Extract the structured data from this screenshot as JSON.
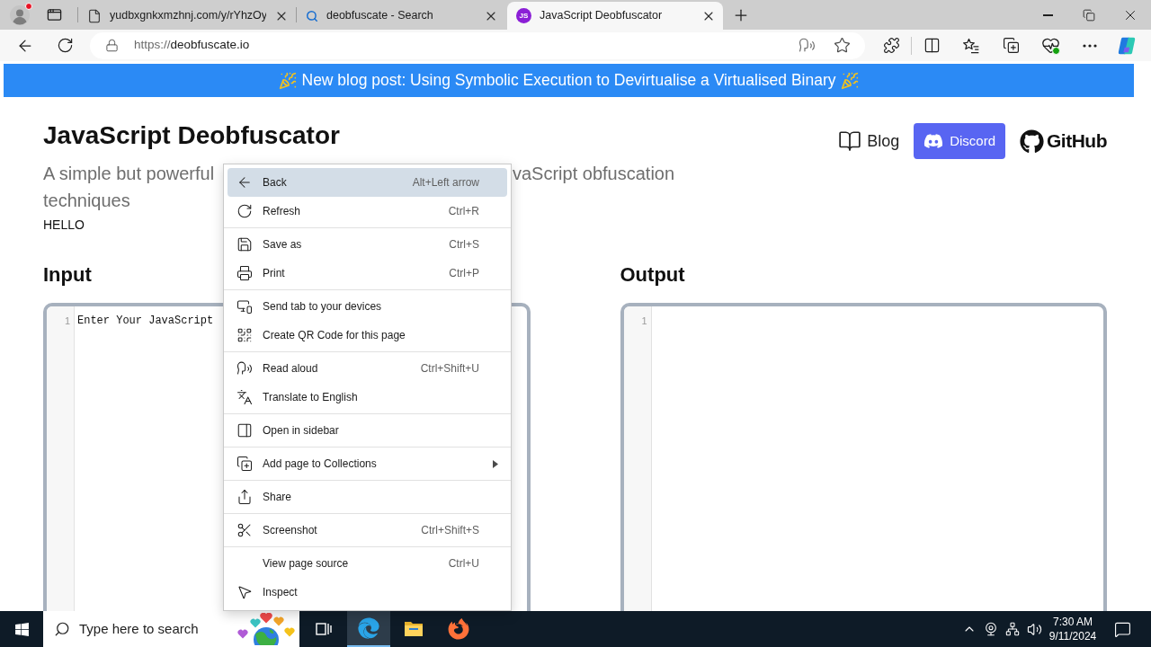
{
  "browser": {
    "tabs": [
      {
        "title": "yudbxgnkxmzhnj.com/y/rYhzOy",
        "selected": false
      },
      {
        "title": "deobfuscate - Search",
        "selected": false
      },
      {
        "title": "JavaScript Deobfuscator",
        "favicon_text": "JS",
        "selected": true
      }
    ],
    "address": {
      "scheme": "https://",
      "host": "deobfuscate.io"
    }
  },
  "page": {
    "banner": {
      "text": "New blog post: Using Symbolic Execution to Devirtualise a Virtualised Binary"
    },
    "title": "JavaScript Deobfuscator",
    "nav": [
      {
        "label": "Blog",
        "kind": "link"
      },
      {
        "label": "Discord",
        "kind": "button"
      },
      {
        "label": "GitHub",
        "kind": "logo"
      }
    ],
    "subtitle": {
      "line_1_start": "A simple but powerful",
      "line_1_end": "vaScript obfuscation",
      "line_2": "techniques"
    },
    "note": "HELLO",
    "input": {
      "heading": "Input",
      "line_numbers": [
        "1"
      ],
      "placeholder": "Enter Your JavaScript"
    },
    "output": {
      "heading": "Output",
      "line_numbers": [
        "1"
      ]
    }
  },
  "context_menu": {
    "groups": [
      [
        {
          "label": "Back",
          "shortcut": "Alt+Left arrow",
          "selected": true,
          "submenu": false
        },
        {
          "label": "Refresh",
          "shortcut": "Ctrl+R",
          "selected": false,
          "submenu": false
        }
      ],
      [
        {
          "label": "Save as",
          "shortcut": "Ctrl+S",
          "selected": false,
          "submenu": false
        },
        {
          "label": "Print",
          "shortcut": "Ctrl+P",
          "selected": false,
          "submenu": false
        }
      ],
      [
        {
          "label": "Send tab to your devices",
          "selected": false,
          "submenu": false
        },
        {
          "label": "Create QR Code for this page",
          "selected": false,
          "submenu": false
        }
      ],
      [
        {
          "label": "Read aloud",
          "shortcut": "Ctrl+Shift+U",
          "selected": false,
          "submenu": false
        },
        {
          "label": "Translate to English",
          "selected": false,
          "submenu": false
        }
      ],
      [
        {
          "label": "Open in sidebar",
          "selected": false,
          "submenu": false
        }
      ],
      [
        {
          "label": "Add page to Collections",
          "selected": false,
          "submenu": true
        }
      ],
      [
        {
          "label": "Share",
          "selected": false,
          "submenu": false
        }
      ],
      [
        {
          "label": "Screenshot",
          "shortcut": "Ctrl+Shift+S",
          "selected": false,
          "submenu": false
        }
      ],
      [
        {
          "label": "View page source",
          "shortcut": "Ctrl+U",
          "selected": false,
          "submenu": false
        },
        {
          "label": "Inspect",
          "selected": false,
          "submenu": false
        }
      ]
    ]
  },
  "taskbar": {
    "search_placeholder": "Type here to search",
    "apps": [
      {
        "selected": true
      },
      {
        "selected": false
      },
      {
        "selected": false
      }
    ],
    "clock": {
      "time": "7:30 AM",
      "date": "9/11/2024"
    }
  }
}
